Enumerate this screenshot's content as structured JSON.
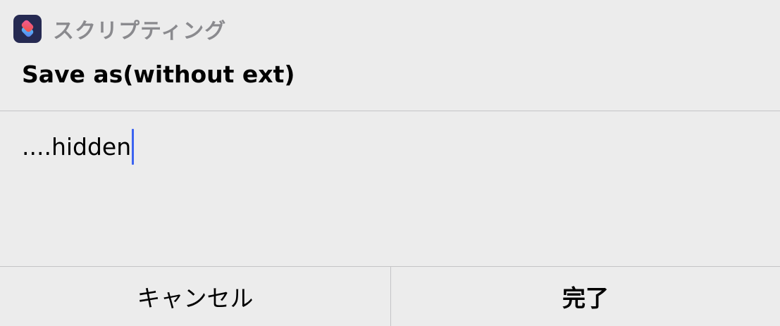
{
  "dialog": {
    "app_icon": "shortcuts-app-icon",
    "app_name": "スクリプティング",
    "prompt_title": "Save as(without ext)",
    "input": {
      "value": "....hidden"
    },
    "buttons": {
      "cancel_label": "キャンセル",
      "done_label": "完了"
    },
    "colors": {
      "background": "#ececec",
      "caret": "#3b63f1",
      "app_name": "#8a8a8e",
      "divider": "#c4c4c6"
    }
  }
}
